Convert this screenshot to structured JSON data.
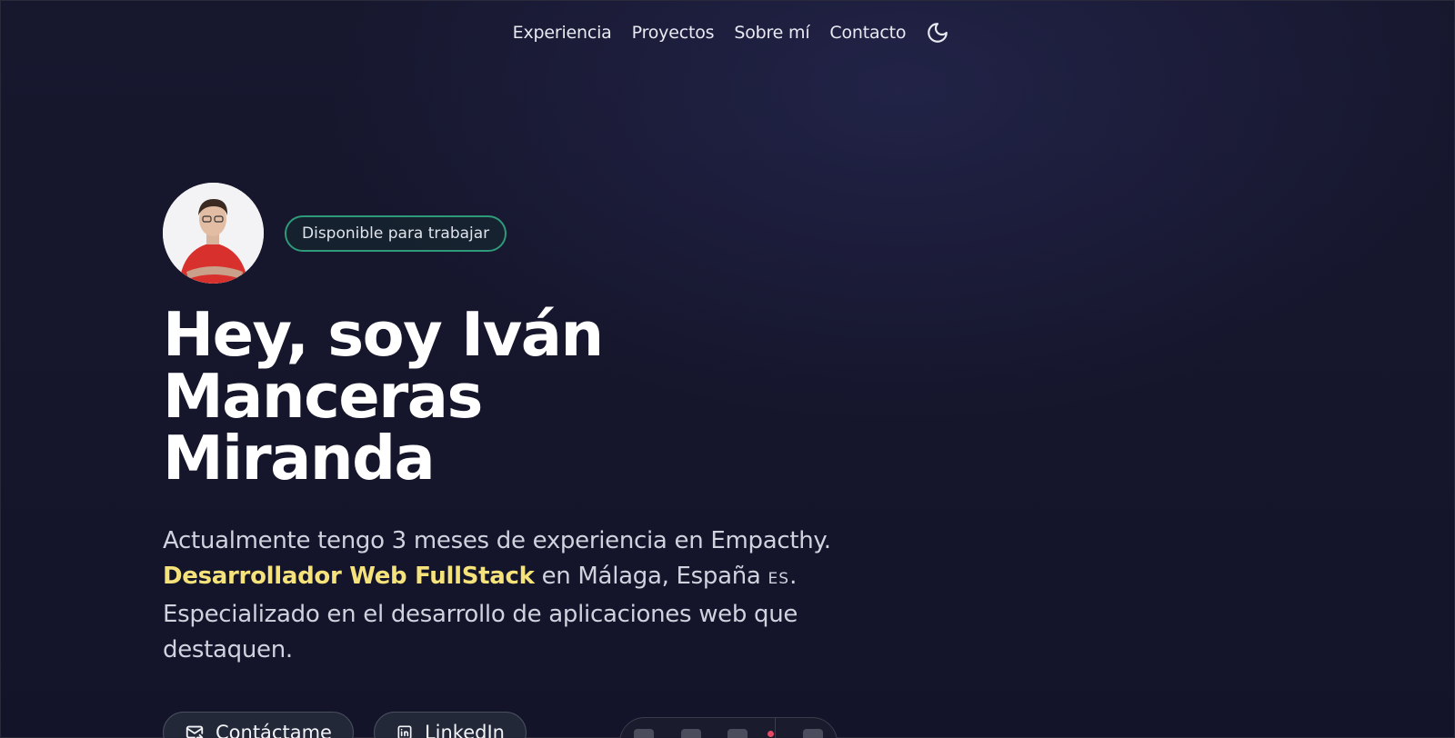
{
  "nav": {
    "items": [
      "Experiencia",
      "Proyectos",
      "Sobre mí",
      "Contacto"
    ],
    "theme_icon": "moon-icon"
  },
  "hero": {
    "badge": "Disponible para trabajar",
    "title_line1": "Hey, soy Iván Manceras",
    "title_line2": "Miranda",
    "desc_part1": "Actualmente tengo 3 meses de experiencia en Empacthy.",
    "desc_highlight": "Desarrollador Web FullStack",
    "desc_part2": " en Málaga, España ",
    "desc_country": "ES",
    "desc_part3": ". Especializado en el desarrollo de aplicaciones web que destaquen.",
    "buttons": {
      "contact_label": "Contáctame",
      "linkedin_label": "LinkedIn"
    }
  },
  "colors": {
    "background": "#15152a",
    "highlight": "#f5e27a",
    "badge_border": "#2f9a7a"
  }
}
